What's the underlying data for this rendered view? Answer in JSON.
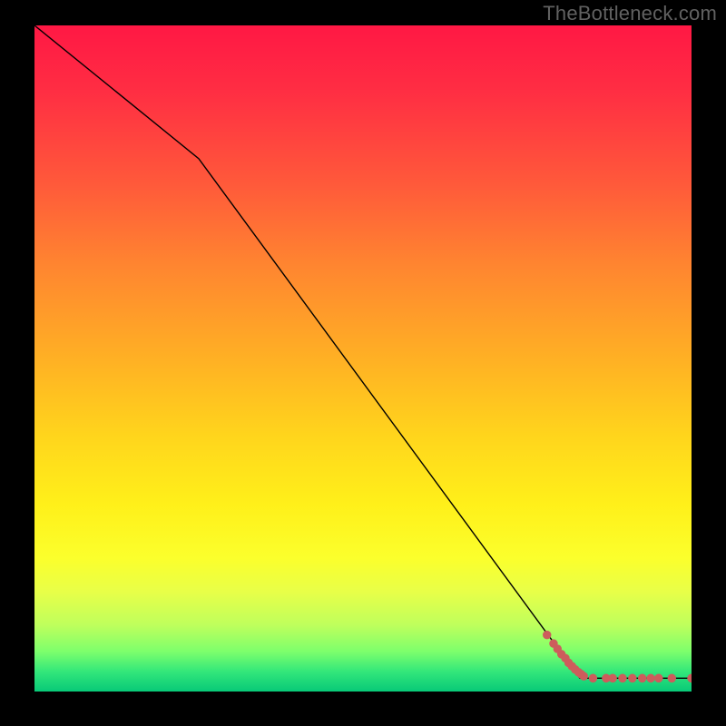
{
  "watermark": "TheBottleneck.com",
  "chart_data": {
    "type": "line",
    "title": "",
    "xlabel": "",
    "ylabel": "",
    "xlim": [
      0,
      100
    ],
    "ylim": [
      0,
      100
    ],
    "series": [
      {
        "name": "curve",
        "x": [
          0,
          25,
          83,
          100
        ],
        "y": [
          100,
          80,
          2,
          2
        ],
        "style": "line",
        "color": "#000000"
      },
      {
        "name": "markers-diagonal",
        "style": "scatter",
        "color": "#cd5c5c",
        "x": [
          78,
          79,
          79.6,
          80.2,
          80.8,
          81.3,
          81.8,
          82.3,
          82.8,
          83.2,
          83.6
        ],
        "y": [
          8.5,
          7.2,
          6.4,
          5.6,
          5.0,
          4.3,
          3.8,
          3.3,
          2.9,
          2.6,
          2.3
        ]
      },
      {
        "name": "markers-flat",
        "style": "scatter",
        "color": "#cd5c5c",
        "x": [
          85,
          87,
          88,
          89.5,
          91,
          92.5,
          93.8,
          95,
          97,
          100
        ],
        "y": [
          2,
          2,
          2,
          2,
          2,
          2,
          2,
          2,
          2,
          2
        ]
      }
    ],
    "background_gradient_stops": [
      {
        "pos": 0.0,
        "color": "#ff1844"
      },
      {
        "pos": 0.5,
        "color": "#ffb024"
      },
      {
        "pos": 0.8,
        "color": "#fbff2c"
      },
      {
        "pos": 1.0,
        "color": "#08c978"
      }
    ]
  }
}
